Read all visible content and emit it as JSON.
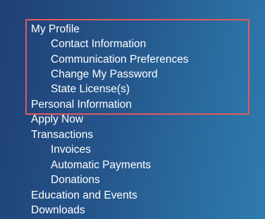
{
  "nav": {
    "items": [
      {
        "label": "My Profile",
        "level": 0
      },
      {
        "label": "Contact Information",
        "level": 1
      },
      {
        "label": "Communication Preferences",
        "level": 1
      },
      {
        "label": "Change My Password",
        "level": 1
      },
      {
        "label": "State License(s)",
        "level": 1
      },
      {
        "label": "Personal Information",
        "level": 0
      },
      {
        "label": "Apply Now",
        "level": 0
      },
      {
        "label": "Transactions",
        "level": 0
      },
      {
        "label": "Invoices",
        "level": 1
      },
      {
        "label": "Automatic Payments",
        "level": 1
      },
      {
        "label": "Donations",
        "level": 1
      },
      {
        "label": "Education and Events",
        "level": 0
      },
      {
        "label": "Downloads",
        "level": 0
      }
    ]
  },
  "colors": {
    "highlight_border": "#e05a5c",
    "text": "#ffffff",
    "background": "#25578c"
  }
}
